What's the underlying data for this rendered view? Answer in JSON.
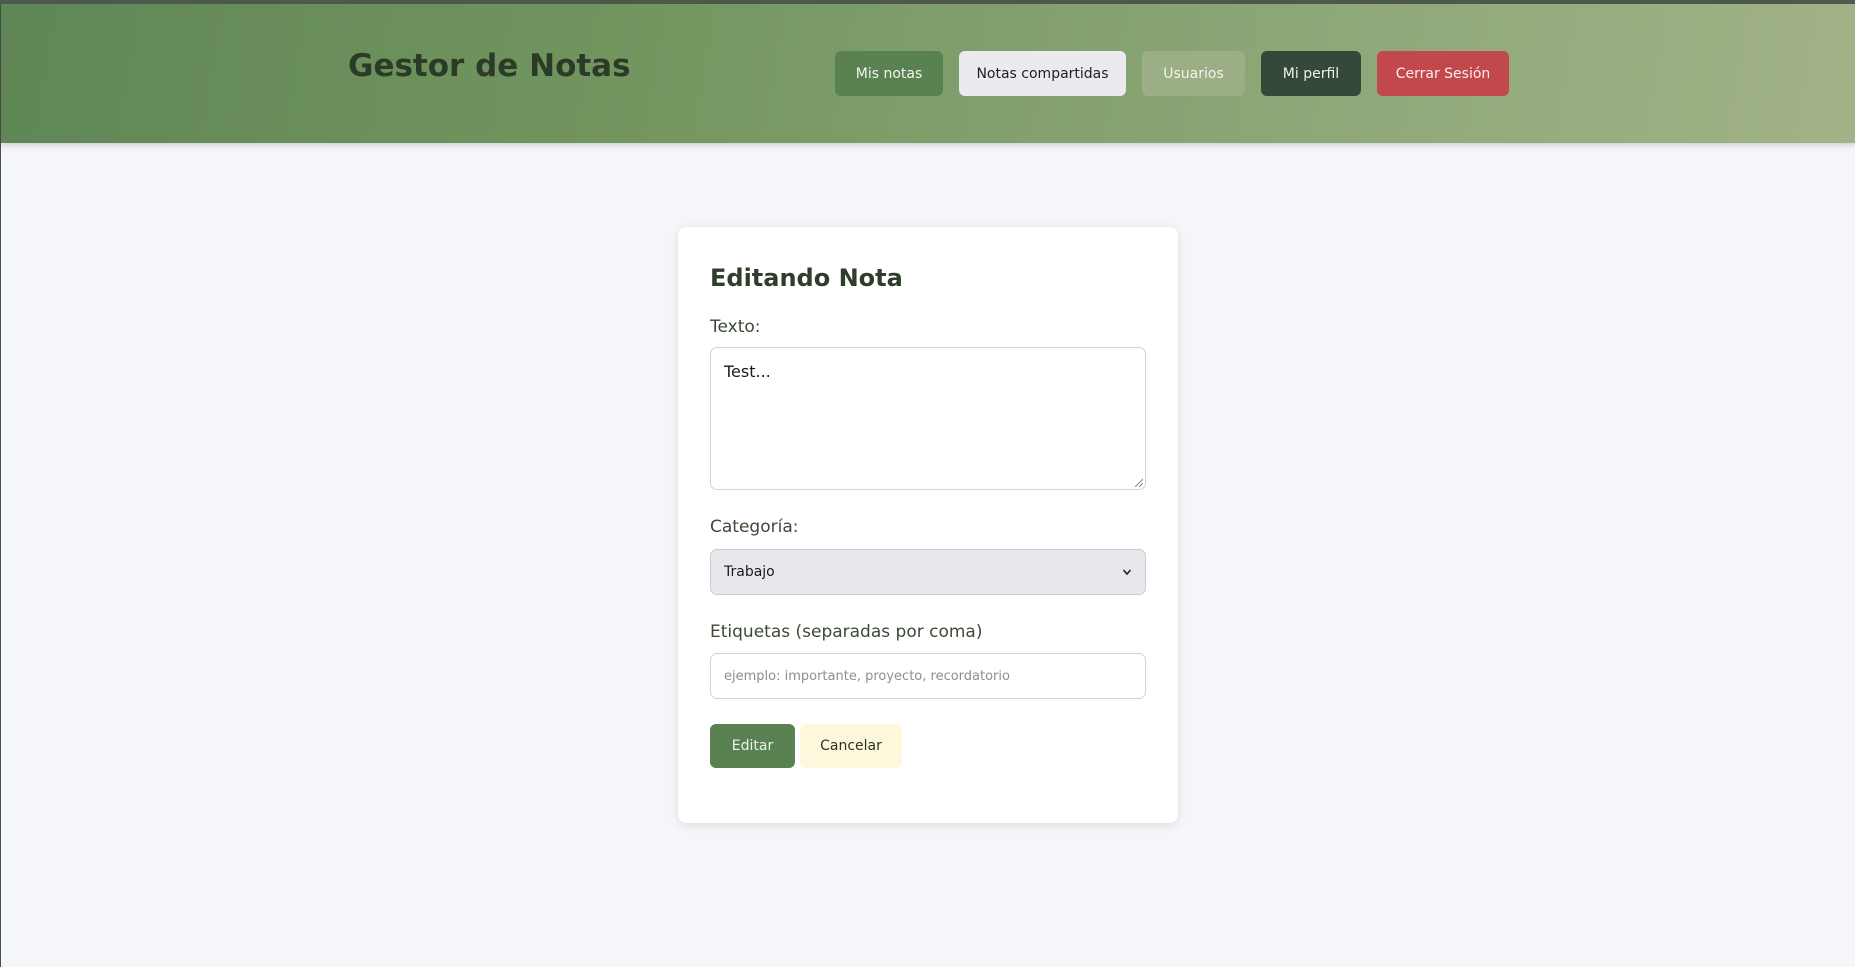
{
  "header": {
    "app_title": "Gestor de Notas",
    "nav": {
      "mis_notas": "Mis notas",
      "notas_compartidas": "Notas compartidas",
      "usuarios": "Usuarios",
      "mi_perfil": "Mi perfil",
      "cerrar_sesion": "Cerrar Sesión"
    }
  },
  "form": {
    "title": "Editando Nota",
    "texto_label": "Texto:",
    "texto_value": "Test...",
    "categoria_label": "Categoría:",
    "categoria_value": "Trabajo",
    "etiquetas_label": "Etiquetas (separadas por coma)",
    "etiquetas_value": "",
    "etiquetas_placeholder": "ejemplo: importante, proyecto, recordatorio",
    "editar_label": "Editar",
    "cancelar_label": "Cancelar"
  },
  "icons": {
    "select_arrow": "chevron-down-icon",
    "resize_grip": "resize-grip-icon"
  },
  "colors": {
    "primary_green": "#5a8152",
    "dark_green": "#34493a",
    "danger_red": "#c3484c",
    "cancel_cream": "#fdf8dc",
    "page_bg": "#f5f6f9"
  }
}
